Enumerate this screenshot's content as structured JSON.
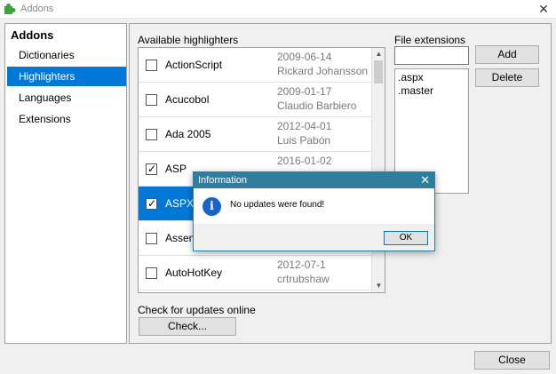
{
  "window": {
    "title": "Addons",
    "app_icon": "puzzle-icon",
    "close_glyph": "✕"
  },
  "sidebar": {
    "heading": "Addons",
    "items": [
      {
        "label": "Dictionaries"
      },
      {
        "label": "Highlighters",
        "selected": true
      },
      {
        "label": "Languages"
      },
      {
        "label": "Extensions"
      }
    ]
  },
  "highlighters": {
    "label": "Available highlighters",
    "rows": [
      {
        "name": "ActionScript",
        "date": "2009-06-14",
        "author": "Rickard Johansson",
        "checked": false
      },
      {
        "name": "Acucobol",
        "date": "2009-01-17",
        "author": "Claudio Barbiero",
        "checked": false
      },
      {
        "name": "Ada 2005",
        "date": "2012-04-01",
        "author": "Luis Pabón",
        "checked": false
      },
      {
        "name": "ASP",
        "date": "2016-01-02",
        "author": "",
        "checked": true
      },
      {
        "name": "ASPX",
        "date": "",
        "author": "",
        "checked": true,
        "selected": true
      },
      {
        "name": "Assem",
        "date": "",
        "author": "",
        "checked": false
      },
      {
        "name": "AutoHotKey",
        "date": "2012-07-1",
        "author": "crtrubshaw",
        "checked": false
      }
    ]
  },
  "extensions": {
    "label": "File extensions",
    "input_value": "",
    "items": [
      ".aspx",
      ".master"
    ],
    "add_label": "Add",
    "delete_label": "Delete"
  },
  "updates": {
    "label": "Check for updates online",
    "check_label": "Check..."
  },
  "footer": {
    "close_label": "Close"
  },
  "dialog": {
    "title": "Information",
    "message": "No updates were found!",
    "ok_label": "OK",
    "close_glyph": "✕",
    "icon_glyph": "i"
  },
  "colors": {
    "selection": "#0078d7",
    "dialog_title": "#2f7ea0"
  }
}
